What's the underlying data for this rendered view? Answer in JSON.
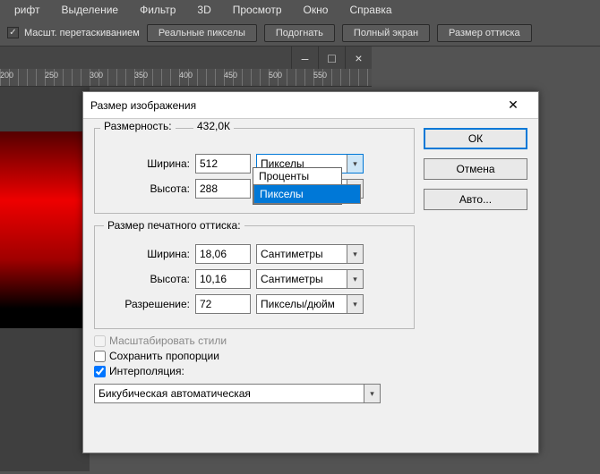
{
  "menu": [
    "рифт",
    "Выделение",
    "Фильтр",
    "3D",
    "Просмотр",
    "Окно",
    "Справка"
  ],
  "toolbar": {
    "drag_zoom": "Масшт. перетаскиванием",
    "buttons": [
      "Реальные пикселы",
      "Подогнать",
      "Полный экран",
      "Размер оттиска"
    ]
  },
  "ruler": [
    "200",
    "250",
    "300",
    "350",
    "400",
    "450",
    "500",
    "550"
  ],
  "dialog": {
    "title": "Размер изображения",
    "size_label": "Размерность:",
    "size_value": "432,0К",
    "width_label": "Ширина:",
    "width_value": "512",
    "height_label": "Высота:",
    "height_value": "288",
    "unit_px": "Пикселы",
    "unit_options": [
      "Проценты",
      "Пикселы"
    ],
    "print_legend": "Размер печатного оттиска:",
    "print_width": "18,06",
    "print_height": "10,16",
    "print_unit": "Сантиметры",
    "res_label": "Разрешение:",
    "res_value": "72",
    "res_unit": "Пикселы/дюйм",
    "scale_styles": "Масштабировать стили",
    "constrain": "Сохранить пропорции",
    "interp_label": "Интерполяция:",
    "interp_value": "Бикубическая автоматическая",
    "ok": "ОК",
    "cancel": "Отмена",
    "auto": "Авто..."
  }
}
